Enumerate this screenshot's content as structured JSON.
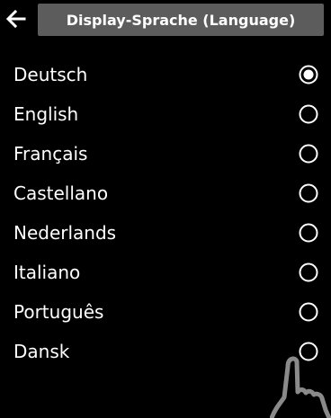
{
  "header": {
    "back_icon": "arrow-left-icon",
    "title": "Display-Sprache (Language)"
  },
  "languages": [
    {
      "label": "Deutsch",
      "selected": true
    },
    {
      "label": "English",
      "selected": false
    },
    {
      "label": "Français",
      "selected": false
    },
    {
      "label": "Castellano",
      "selected": false
    },
    {
      "label": "Nederlands",
      "selected": false
    },
    {
      "label": "Italiano",
      "selected": false
    },
    {
      "label": "Português",
      "selected": false
    },
    {
      "label": "Dansk",
      "selected": false
    }
  ],
  "colors": {
    "background": "#000000",
    "title_bar": "#5c5c5c",
    "text": "#ffffff",
    "finger_outline": "#8a8a8a"
  }
}
